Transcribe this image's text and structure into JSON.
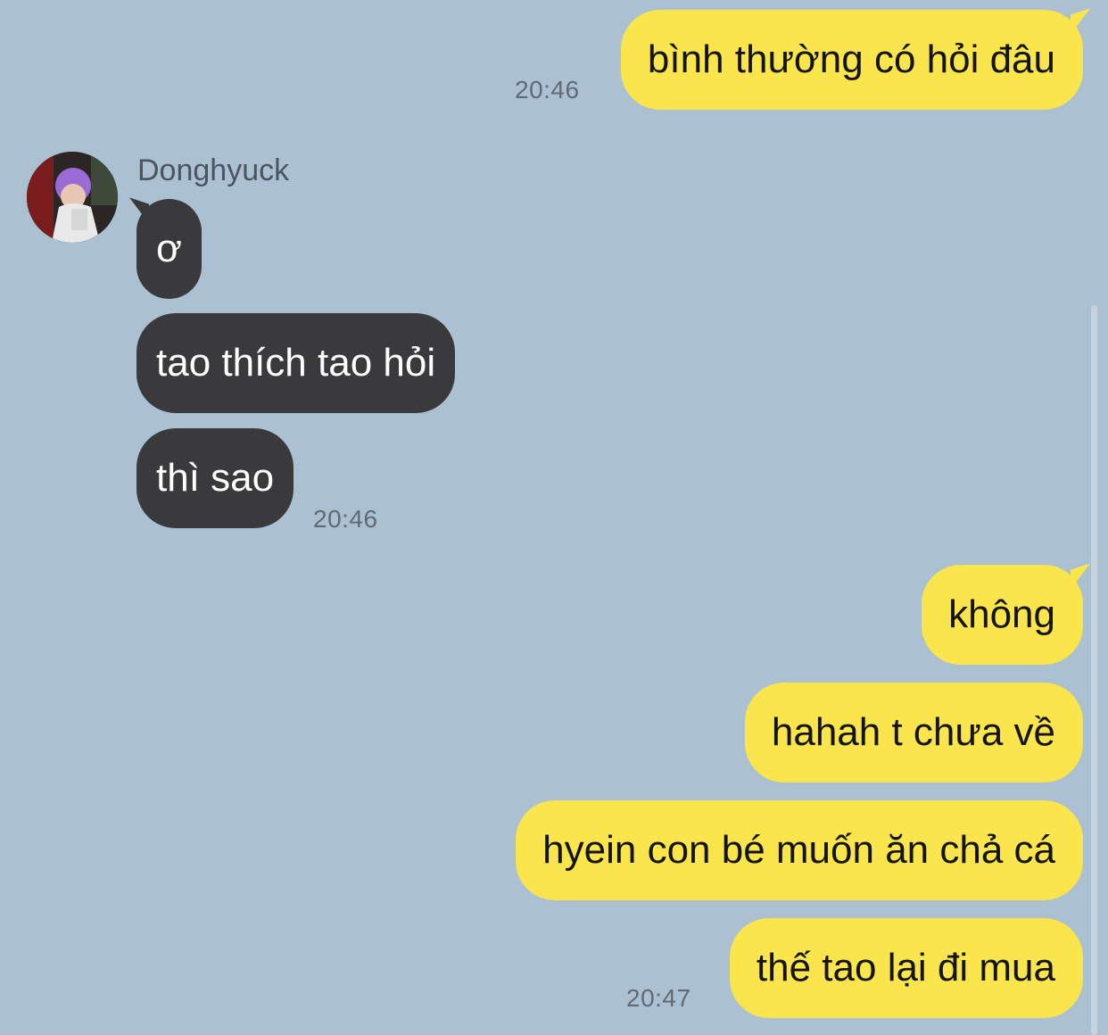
{
  "conversation": {
    "contact": {
      "name": "Donghyuck",
      "avatar_icon": "profile-photo-icon"
    },
    "colors": {
      "background": "#abc1d1",
      "outgoing_bubble": "#fae54d",
      "incoming_bubble": "#3a3a3c"
    },
    "messages": [
      {
        "direction": "outgoing",
        "text": "bình thường có hỏi đâu",
        "time": "20:46"
      },
      {
        "direction": "incoming",
        "text": "ơ",
        "time": ""
      },
      {
        "direction": "incoming",
        "text": "tao thích tao hỏi",
        "time": ""
      },
      {
        "direction": "incoming",
        "text": "thì sao",
        "time": "20:46"
      },
      {
        "direction": "outgoing",
        "text": "không",
        "time": ""
      },
      {
        "direction": "outgoing",
        "text": "hahah t chưa về",
        "time": ""
      },
      {
        "direction": "outgoing",
        "text": "hyein con bé muốn ăn chả cá",
        "time": ""
      },
      {
        "direction": "outgoing",
        "text": "thế tao lại đi mua",
        "time": "20:47"
      }
    ]
  }
}
